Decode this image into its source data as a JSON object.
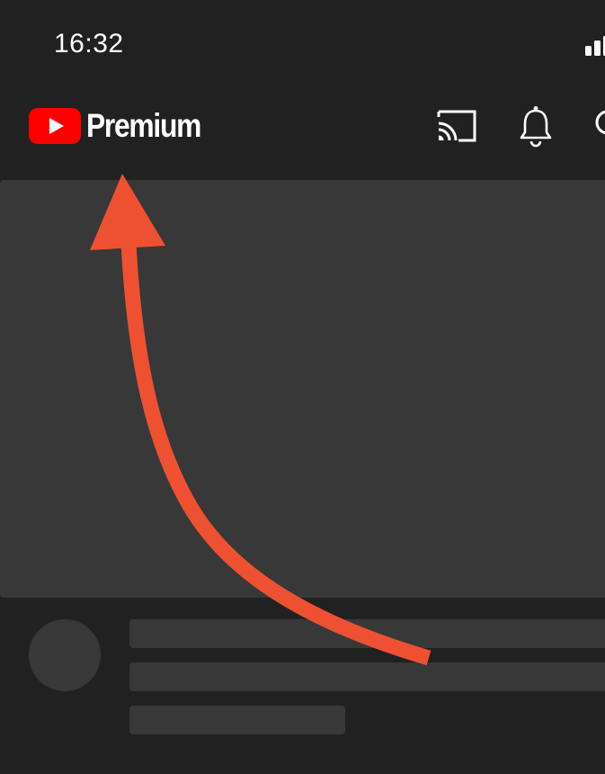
{
  "status_bar": {
    "time": "16:32"
  },
  "header": {
    "logo_text": "Premium",
    "brand_color": "#FF0000",
    "icons": [
      "cast-icon",
      "bell-icon",
      "search-icon"
    ]
  },
  "annotation": {
    "arrow_color": "#EE5131",
    "target": "logo"
  },
  "colors": {
    "background": "#212121",
    "placeholder": "#383838"
  }
}
